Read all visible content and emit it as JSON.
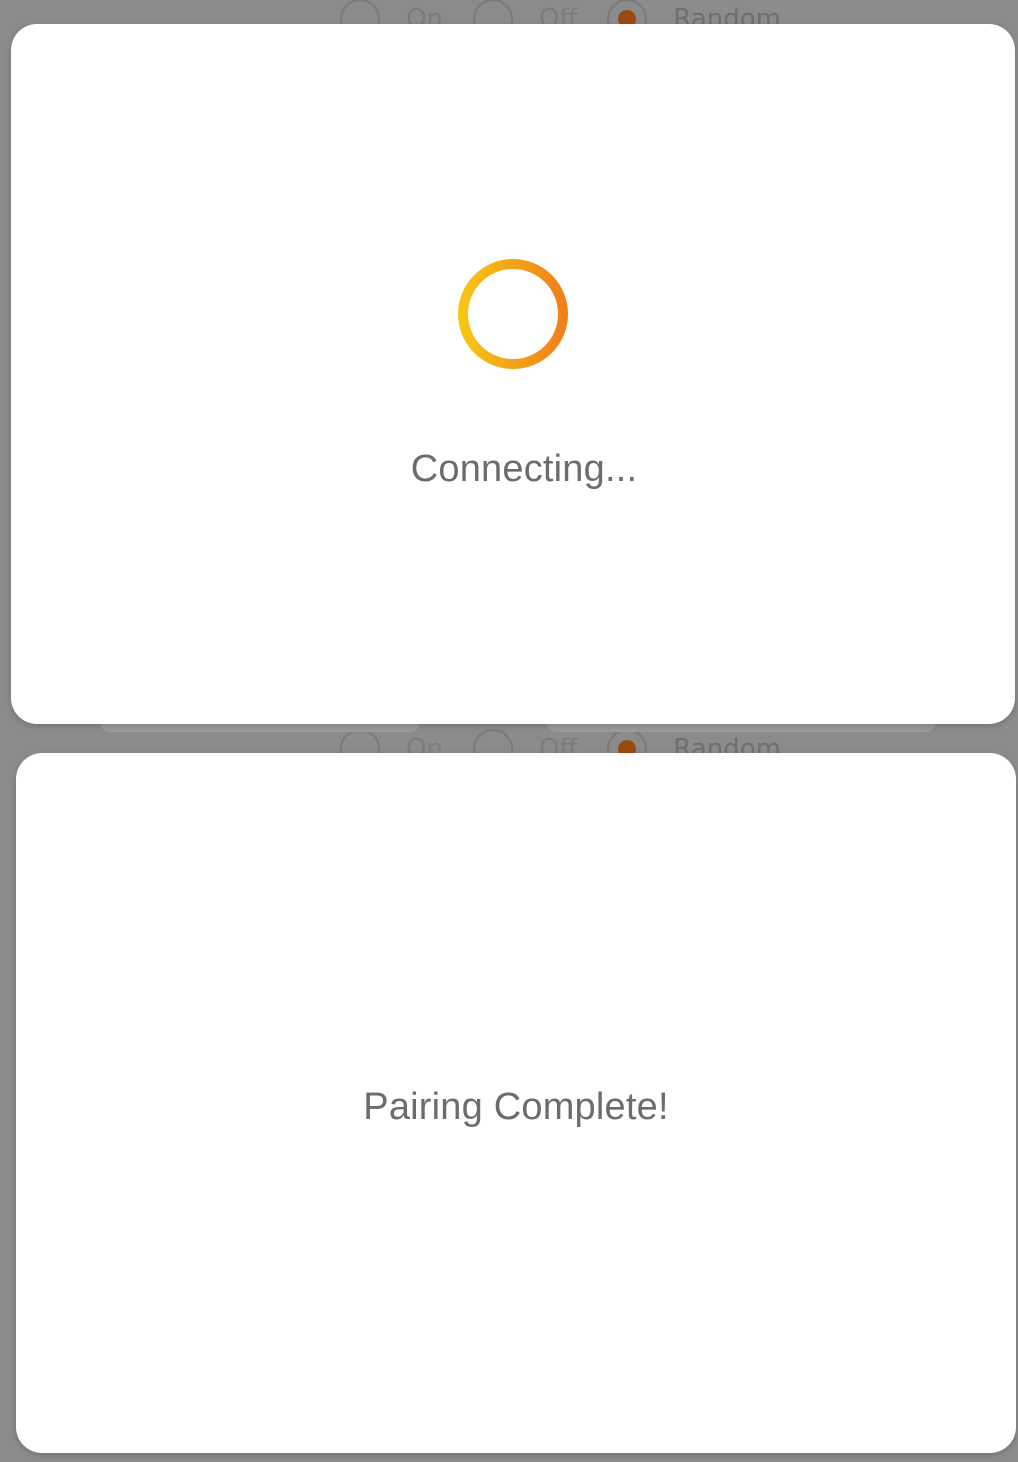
{
  "background": {
    "radio_options": [
      "On",
      "Off",
      "Random"
    ],
    "selected_option": "Random",
    "accent_color": "#9a4a10"
  },
  "connecting_dialog": {
    "spinner_icon": "loading-spinner-icon",
    "spinner_colors": [
      "#f8c514",
      "#f0801a"
    ],
    "message": "Connecting..."
  },
  "complete_dialog": {
    "message": "Pairing Complete!"
  }
}
